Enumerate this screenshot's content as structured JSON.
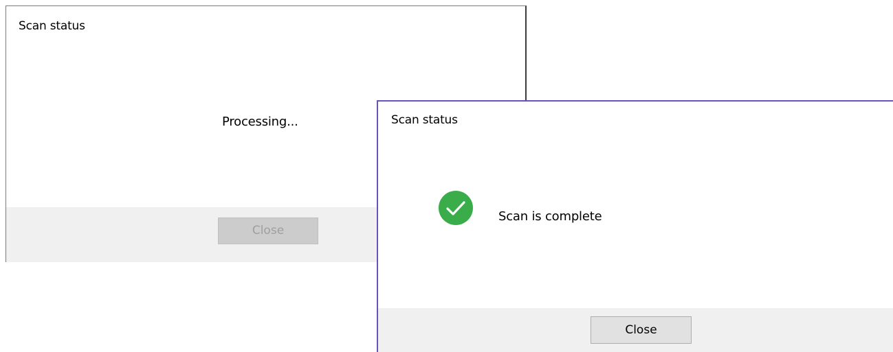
{
  "dialogs": {
    "processing": {
      "title": "Scan status",
      "message": "Processing...",
      "close_label": "Close",
      "close_enabled": false
    },
    "complete": {
      "title": "Scan status",
      "message": "Scan is complete",
      "close_label": "Close",
      "close_enabled": true,
      "status_icon": "checkmark-circle-icon"
    }
  },
  "colors": {
    "success_green": "#3aad4a",
    "active_window_border": "#6b4fbb",
    "footer_background": "#f0f0f0",
    "disabled_button": "#cccccc",
    "enabled_button": "#e1e1e1"
  }
}
